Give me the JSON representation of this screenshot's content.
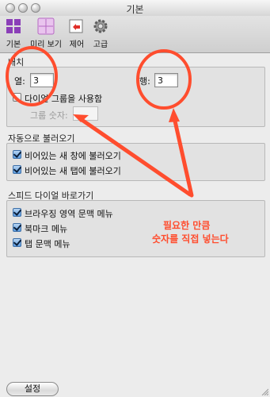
{
  "window": {
    "title": "기본"
  },
  "toolbar": {
    "items": [
      {
        "label": "기본",
        "icon": "basic-grid-icon"
      },
      {
        "label": "미리 보기",
        "icon": "preview-grid-icon"
      },
      {
        "label": "제어",
        "icon": "control-icon"
      },
      {
        "label": "고급",
        "icon": "gear-icon"
      }
    ]
  },
  "layout": {
    "section_label": "배치",
    "columns_label": "열:",
    "columns_value": "3",
    "rows_label": "행:",
    "rows_value": "3",
    "use_groups_label": "다이얼 그룹을 사용함",
    "use_groups_checked": false,
    "group_count_label": "그룹 숫자:",
    "group_count_value": ""
  },
  "autoload": {
    "section_label": "자동으로 불러오기",
    "items": [
      {
        "label": "비어있는 새 창에 불러오기",
        "checked": true
      },
      {
        "label": "비어있는 새 탭에 불러오기",
        "checked": true
      }
    ]
  },
  "shortcuts": {
    "section_label": "스피드 다이얼 바로가기",
    "items": [
      {
        "label": "브라우징 영역 문맥 메뉴",
        "checked": true
      },
      {
        "label": "북마크 메뉴",
        "checked": true
      },
      {
        "label": "탭 문맥 메뉴",
        "checked": true
      }
    ]
  },
  "footer": {
    "settings_button": "설정"
  },
  "annotation": {
    "line1": "필요한 만큼",
    "line2": "숫자를 직접 넣는다",
    "color": "#ff4d2e"
  }
}
